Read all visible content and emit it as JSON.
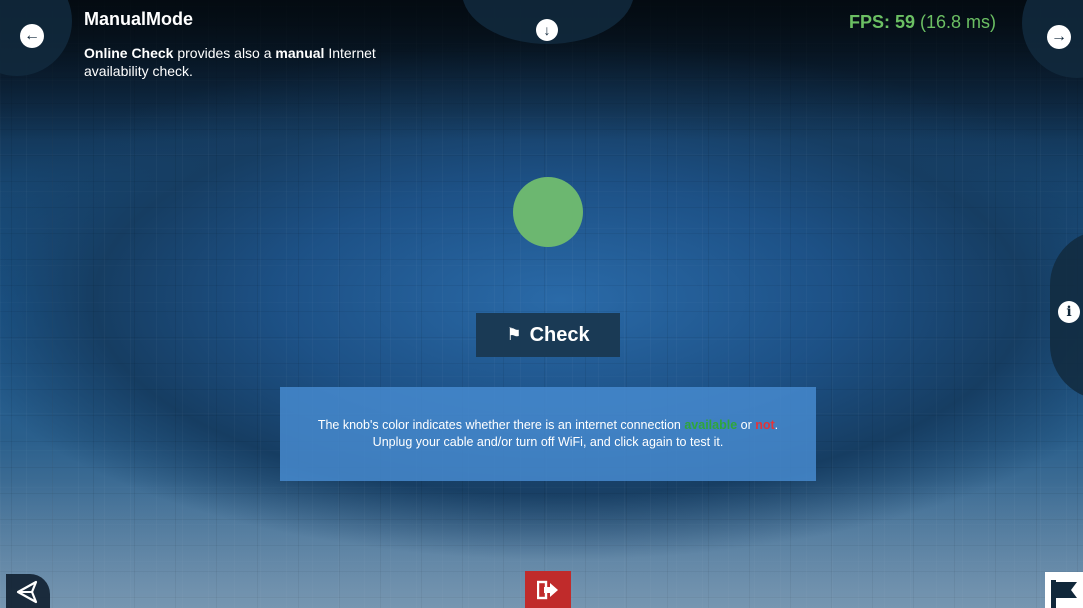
{
  "header": {
    "title": "ManualMode",
    "description_bold_1": "Online Check",
    "description_text_1": " provides also a ",
    "description_bold_2": "manual",
    "description_text_2": " Internet availability check."
  },
  "fps": {
    "label": "FPS: 59",
    "ms": " (16.8 ms)"
  },
  "knob": {
    "color": "#6cb770"
  },
  "check_button": {
    "label": "Check"
  },
  "notice": {
    "line1_prefix": "The knob's color indicates whether there is an internet connection ",
    "available": "available",
    "or": " or ",
    "not": "not",
    "period": ".",
    "line2": "Unplug your cable and/or turn off WiFi, and click again to test it."
  },
  "colors": {
    "accent_green": "#6bbf63",
    "available": "#2fa63a",
    "not": "#e3343a",
    "exit": "#c02b2b"
  },
  "icons": [
    "arrow-left-circle-icon",
    "arrow-right-circle-icon",
    "arrow-down-circle-icon",
    "info-icon",
    "flag-icon",
    "unity-logo-icon",
    "exit-icon",
    "flag-corner-icon"
  ]
}
